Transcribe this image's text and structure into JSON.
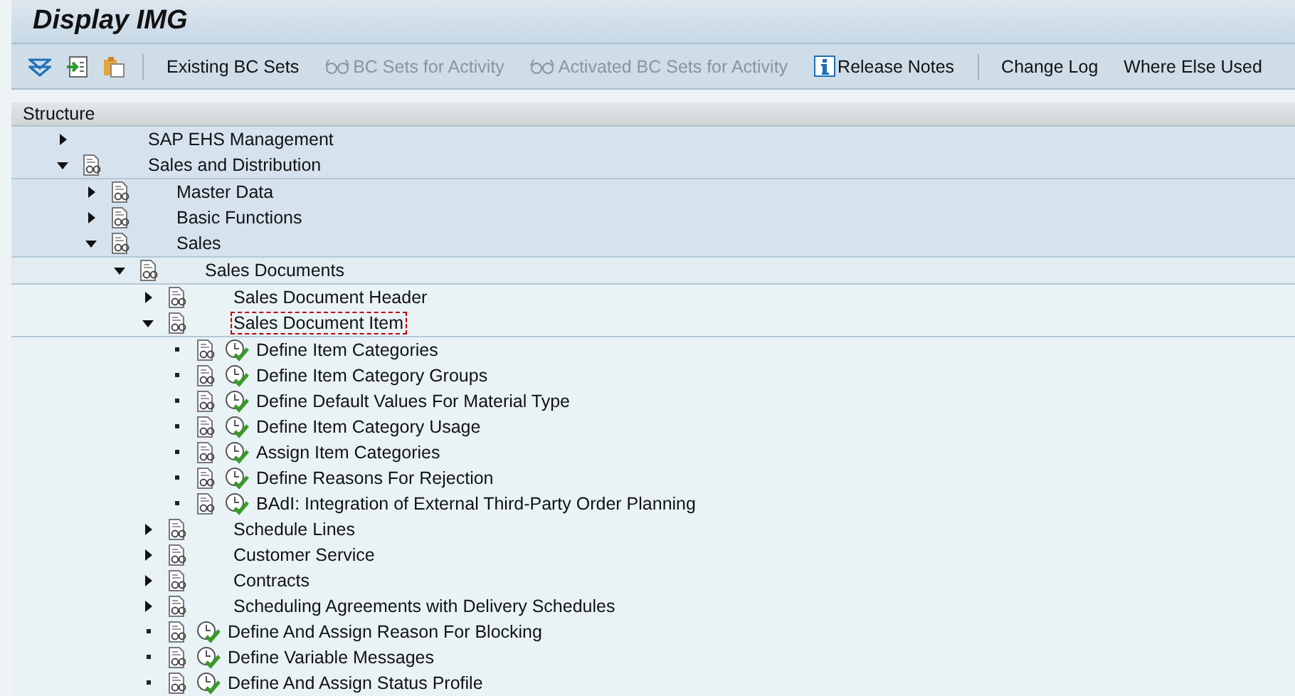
{
  "window": {
    "title": "Display IMG"
  },
  "toolbar": [
    {
      "kind": "icon"
    },
    {
      "kind": "icon"
    },
    {
      "kind": "icon"
    },
    {
      "kind": "separator"
    },
    {
      "kind": "button",
      "label": "Existing BC Sets",
      "disabled": false
    },
    {
      "kind": "button",
      "label": "BC Sets for Activity",
      "disabled": true
    },
    {
      "kind": "button",
      "label": "Activated BC Sets for Activity",
      "disabled": true
    },
    {
      "kind": "button",
      "label": "Release Notes",
      "disabled": false
    },
    {
      "kind": "separator"
    },
    {
      "kind": "button",
      "label": "Change Log",
      "disabled": false
    },
    {
      "kind": "button",
      "label": "Where Else Used",
      "disabled": false
    }
  ],
  "structure": {
    "header": "Structure",
    "tree": [
      {
        "kind": "folder",
        "label": "SAP EHS Management",
        "doc": false,
        "expanded": false,
        "selected": false
      },
      {
        "kind": "folder",
        "label": "Sales and Distribution",
        "doc": true,
        "expanded": true,
        "selected": false,
        "children": [
          {
            "kind": "folder",
            "label": "Master Data",
            "doc": true,
            "expanded": false,
            "selected": false
          },
          {
            "kind": "folder",
            "label": "Basic Functions",
            "doc": true,
            "expanded": false,
            "selected": false
          },
          {
            "kind": "folder",
            "label": "Sales",
            "doc": true,
            "expanded": true,
            "selected": false,
            "children": [
              {
                "kind": "folder",
                "label": "Sales Documents",
                "doc": true,
                "expanded": true,
                "selected": false,
                "children": [
                  {
                    "kind": "folder",
                    "label": "Sales Document Header",
                    "doc": true,
                    "expanded": false,
                    "selected": false
                  },
                  {
                    "kind": "folder",
                    "label": "Sales Document Item",
                    "doc": true,
                    "expanded": true,
                    "selected": true,
                    "children": [
                      {
                        "kind": "activity",
                        "label": "Define Item Categories",
                        "doc": true,
                        "selected": false
                      },
                      {
                        "kind": "activity",
                        "label": "Define Item Category Groups",
                        "doc": true,
                        "selected": false
                      },
                      {
                        "kind": "activity",
                        "label": "Define Default Values For Material Type",
                        "doc": true,
                        "selected": false
                      },
                      {
                        "kind": "activity",
                        "label": "Define Item Category Usage",
                        "doc": true,
                        "selected": false
                      },
                      {
                        "kind": "activity",
                        "label": "Assign Item Categories",
                        "doc": true,
                        "selected": false
                      },
                      {
                        "kind": "activity",
                        "label": "Define Reasons For Rejection",
                        "doc": true,
                        "selected": false
                      },
                      {
                        "kind": "activity",
                        "label": "BAdI: Integration of External Third-Party Order Planning",
                        "doc": true,
                        "selected": false
                      }
                    ]
                  },
                  {
                    "kind": "folder",
                    "label": "Schedule Lines",
                    "doc": true,
                    "expanded": false,
                    "selected": false
                  },
                  {
                    "kind": "folder",
                    "label": "Customer Service",
                    "doc": true,
                    "expanded": false,
                    "selected": false
                  },
                  {
                    "kind": "folder",
                    "label": "Contracts",
                    "doc": true,
                    "expanded": false,
                    "selected": false
                  },
                  {
                    "kind": "folder",
                    "label": "Scheduling Agreements with Delivery Schedules",
                    "doc": true,
                    "expanded": false,
                    "selected": false
                  },
                  {
                    "kind": "activity",
                    "label": "Define And Assign Reason For Blocking",
                    "doc": true,
                    "selected": false
                  },
                  {
                    "kind": "activity",
                    "label": "Define Variable Messages",
                    "doc": true,
                    "selected": false
                  },
                  {
                    "kind": "activity",
                    "label": "Define And Assign Status Profile",
                    "doc": true,
                    "selected": false
                  }
                ]
              }
            ]
          }
        ]
      }
    ]
  }
}
